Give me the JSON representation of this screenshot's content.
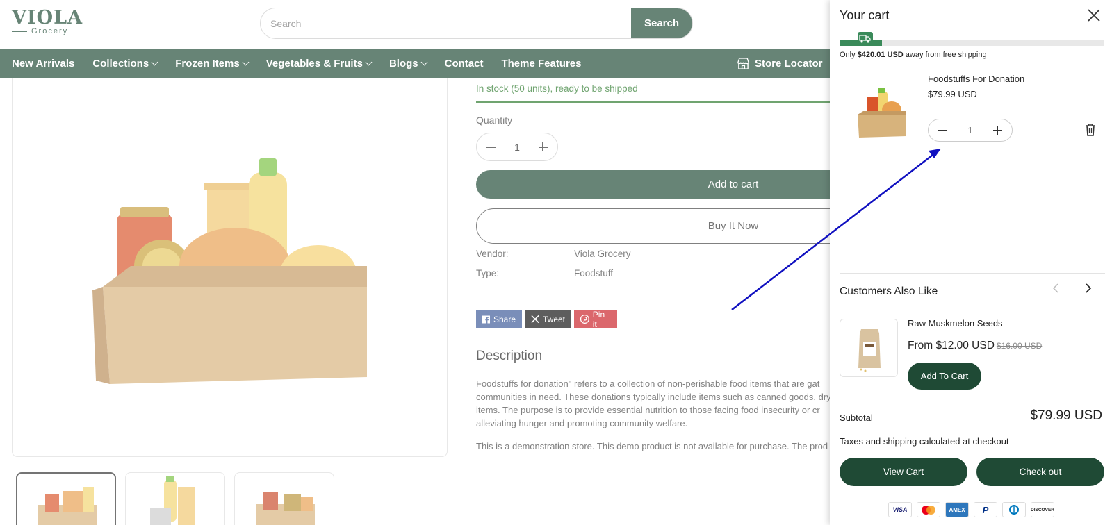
{
  "header": {
    "logo_main": "VIOLA",
    "logo_sub": "Grocery",
    "search_placeholder": "Search",
    "search_button": "Search"
  },
  "nav": {
    "items": [
      {
        "label": "New Arrivals",
        "dropdown": false
      },
      {
        "label": "Collections",
        "dropdown": true
      },
      {
        "label": "Frozen Items",
        "dropdown": true
      },
      {
        "label": "Vegetables & Fruits",
        "dropdown": true
      },
      {
        "label": "Blogs",
        "dropdown": true
      },
      {
        "label": "Contact",
        "dropdown": false
      },
      {
        "label": "Theme Features",
        "dropdown": false
      }
    ],
    "store_locator": "Store Locator"
  },
  "product": {
    "stock": "In stock (50 units), ready to be shipped",
    "quantity_label": "Quantity",
    "quantity": "1",
    "add_to_cart": "Add to cart",
    "buy_now": "Buy It Now",
    "vendor_label": "Vendor:",
    "vendor": "Viola Grocery",
    "type_label": "Type:",
    "type": "Foodstuff",
    "share": {
      "facebook": "Share",
      "x": "Tweet",
      "pinterest": "Pin it"
    },
    "description_title": "Description",
    "description_lines": [
      "Foodstuffs for donation\" refers to a collection of non-perishable food items that are gat",
      "communities in need. These donations typically include items such as canned goods, dry",
      "items. The purpose is to provide essential nutrition to those facing food insecurity or cr",
      "alleviating hunger and promoting community welfare."
    ],
    "disclaimer": "This is a demonstration store. This demo product is not available for purchase. The prod"
  },
  "cart": {
    "title": "Your cart",
    "shipping_progress": 0.16,
    "shipping_prefix": "Only ",
    "shipping_amount": "$420.01 USD",
    "shipping_suffix": " away from free shipping",
    "item": {
      "name": "Foodstuffs For Donation",
      "price": "$79.99 USD",
      "quantity": "1"
    },
    "also_like_title": "Customers Also Like",
    "recommendation": {
      "name": "Raw Muskmelon Seeds",
      "price": "From $12.00 USD",
      "compare_price": "$16.00 USD",
      "add_button": "Add To Cart"
    },
    "subtotal_label": "Subtotal",
    "subtotal": "$79.99 USD",
    "tax_note": "Taxes and shipping calculated at checkout",
    "view_cart": "View Cart",
    "checkout": "Check out",
    "payments": [
      {
        "label": "VISA",
        "color": "#1a1f71"
      },
      {
        "label": "mastercard",
        "color": "#eb001b"
      },
      {
        "label": "AMEX",
        "color": "#2e77bc"
      },
      {
        "label": "P",
        "color": "#003087"
      },
      {
        "label": "D",
        "color": "#0079be"
      },
      {
        "label": "DISCOVER",
        "color": "#333333"
      }
    ]
  },
  "colors": {
    "brand": "#1f4a35",
    "stock": "#2d7a2d",
    "annotation_arrow": "#1010c0"
  }
}
